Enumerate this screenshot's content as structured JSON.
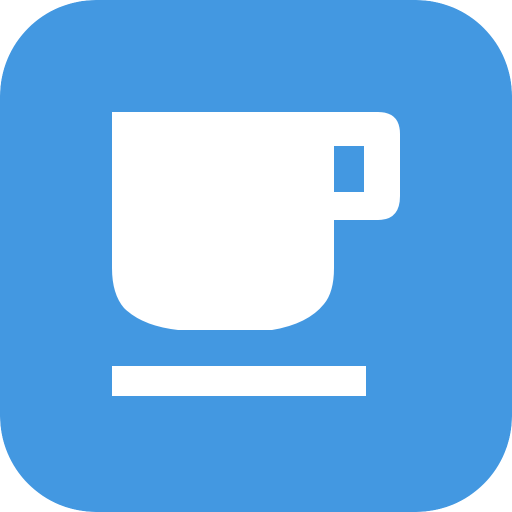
{
  "app_icon": {
    "icon": "coffee-cup-icon",
    "background_color": "#4398e1",
    "glyph_color": "#ffffff"
  }
}
